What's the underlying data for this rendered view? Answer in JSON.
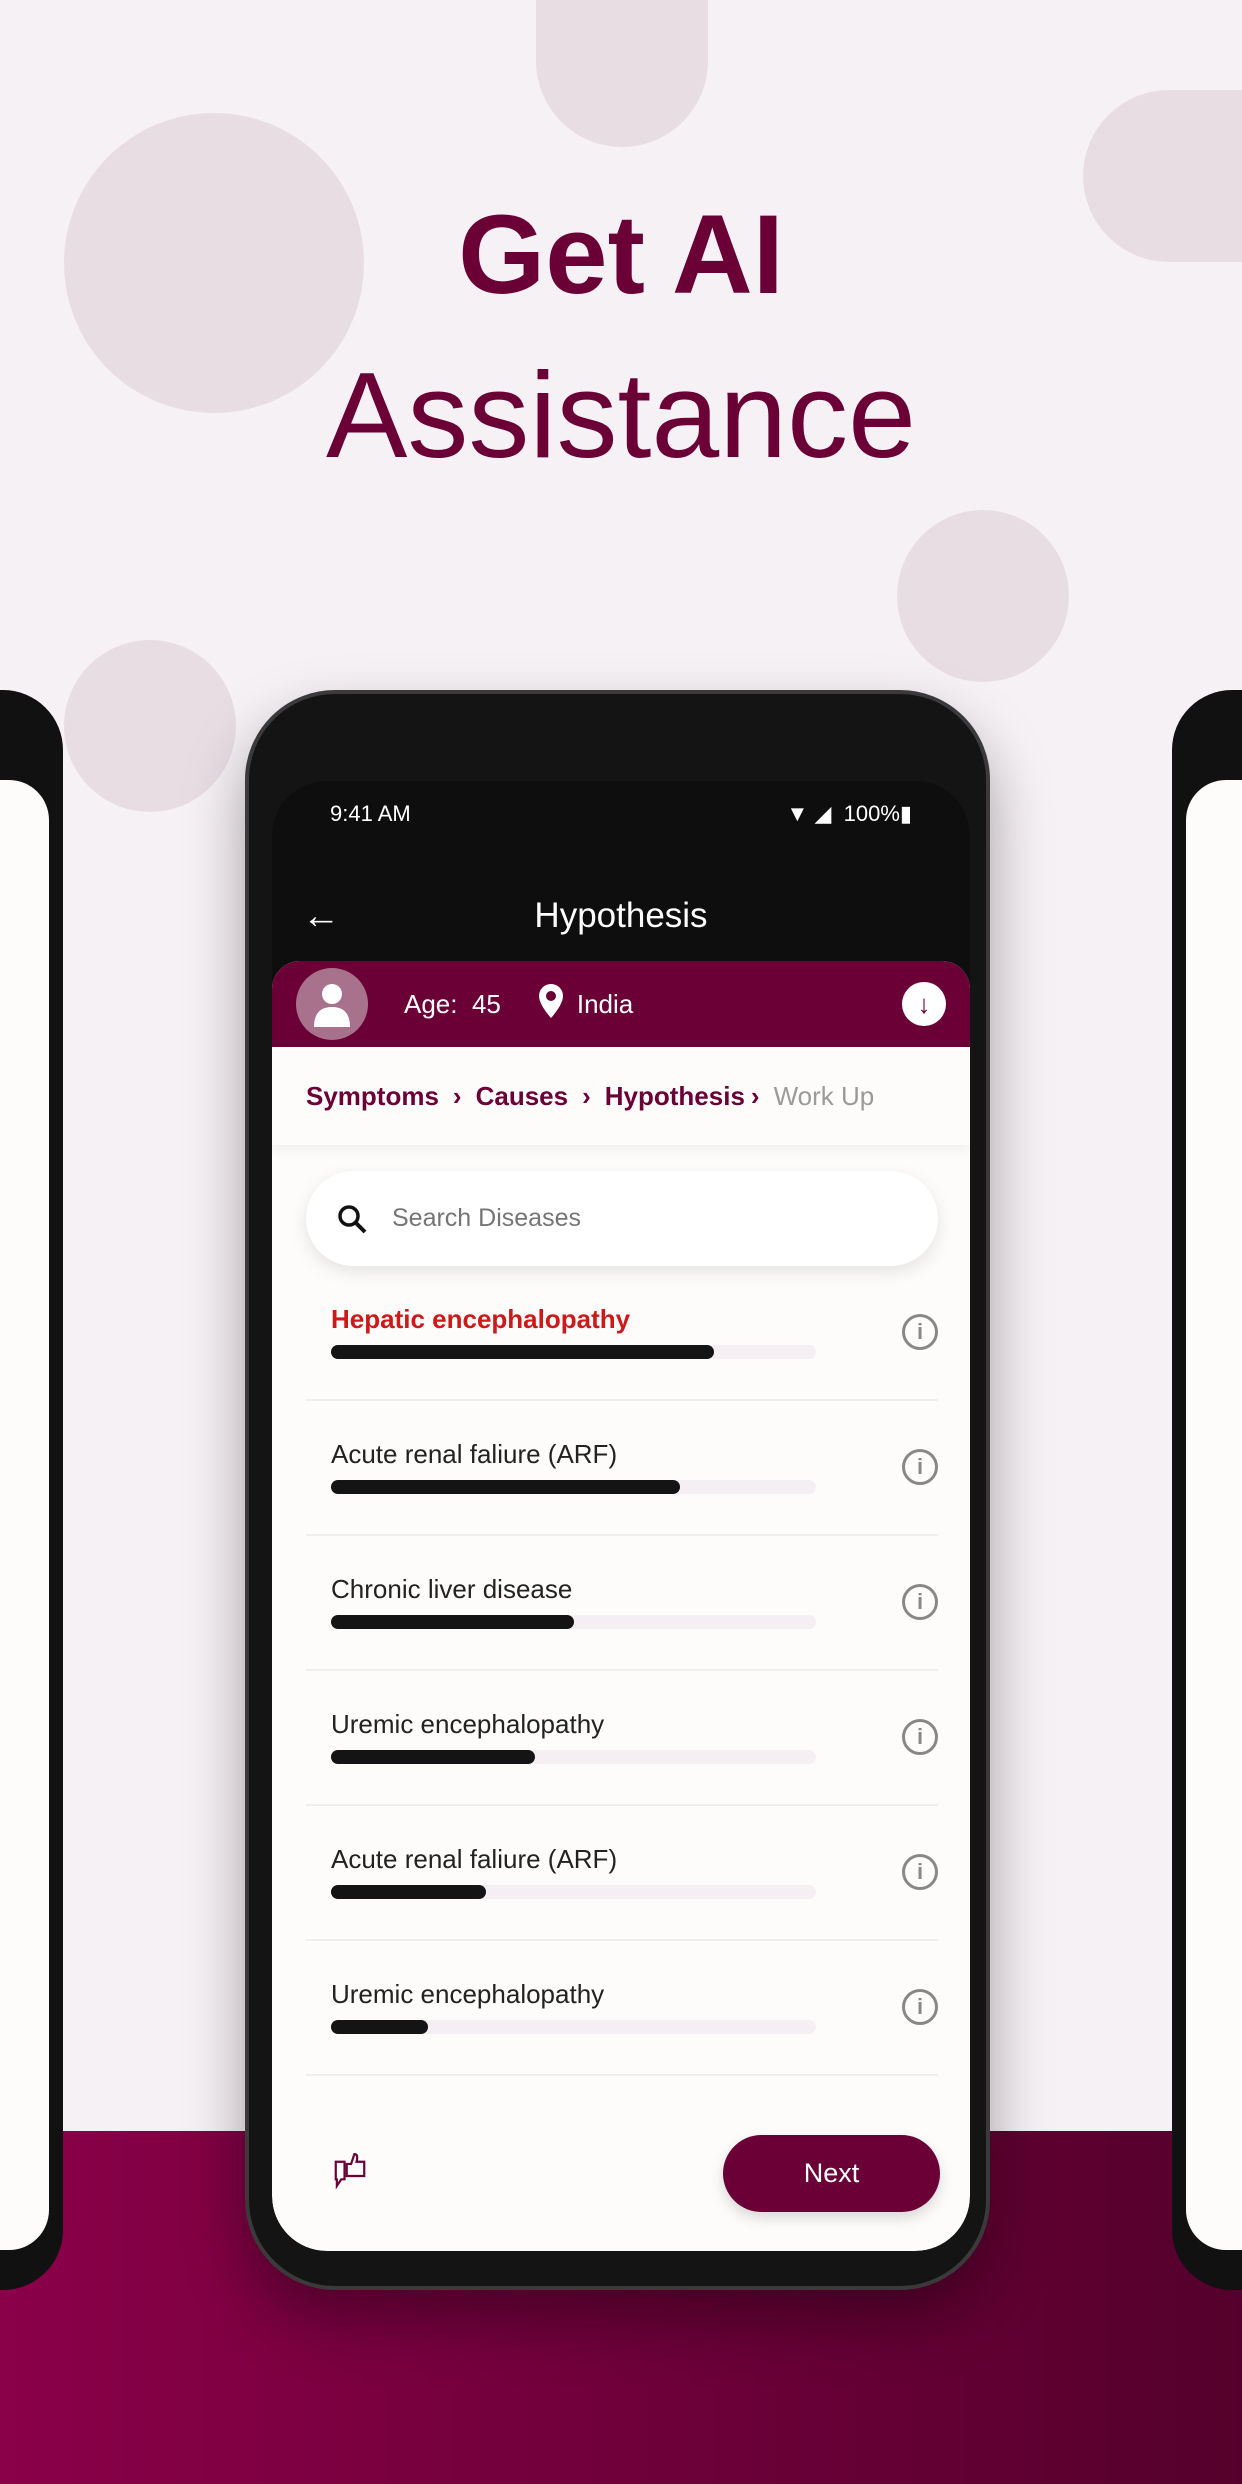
{
  "hero": {
    "line1": "Get AI",
    "line2": "Assistance"
  },
  "status": {
    "time": "9:41 AM",
    "battery": "100%"
  },
  "appbar": {
    "title": "Hypothesis"
  },
  "patient": {
    "age_label": "Age:",
    "age": "45",
    "location": "India"
  },
  "breadcrumb": [
    {
      "label": "Symptoms"
    },
    {
      "label": "Causes"
    },
    {
      "label": "Hypothesis"
    },
    {
      "label": "Work Up"
    }
  ],
  "search": {
    "placeholder": "Search Diseases"
  },
  "diseases": [
    {
      "name": "Hepatic encephalopathy",
      "score": 0.79,
      "highlight": true
    },
    {
      "name": "Acute renal faliure (ARF)",
      "score": 0.72
    },
    {
      "name": "Chronic liver disease",
      "score": 0.5
    },
    {
      "name": "Uremic encephalopathy",
      "score": 0.42
    },
    {
      "name": "Acute renal faliure (ARF)",
      "score": 0.32
    },
    {
      "name": "Uremic encephalopathy",
      "score": 0.2
    }
  ],
  "footer": {
    "next_label": "Next"
  },
  "colors": {
    "brand": "#6b0037",
    "highlight": "#cc1a1a"
  }
}
